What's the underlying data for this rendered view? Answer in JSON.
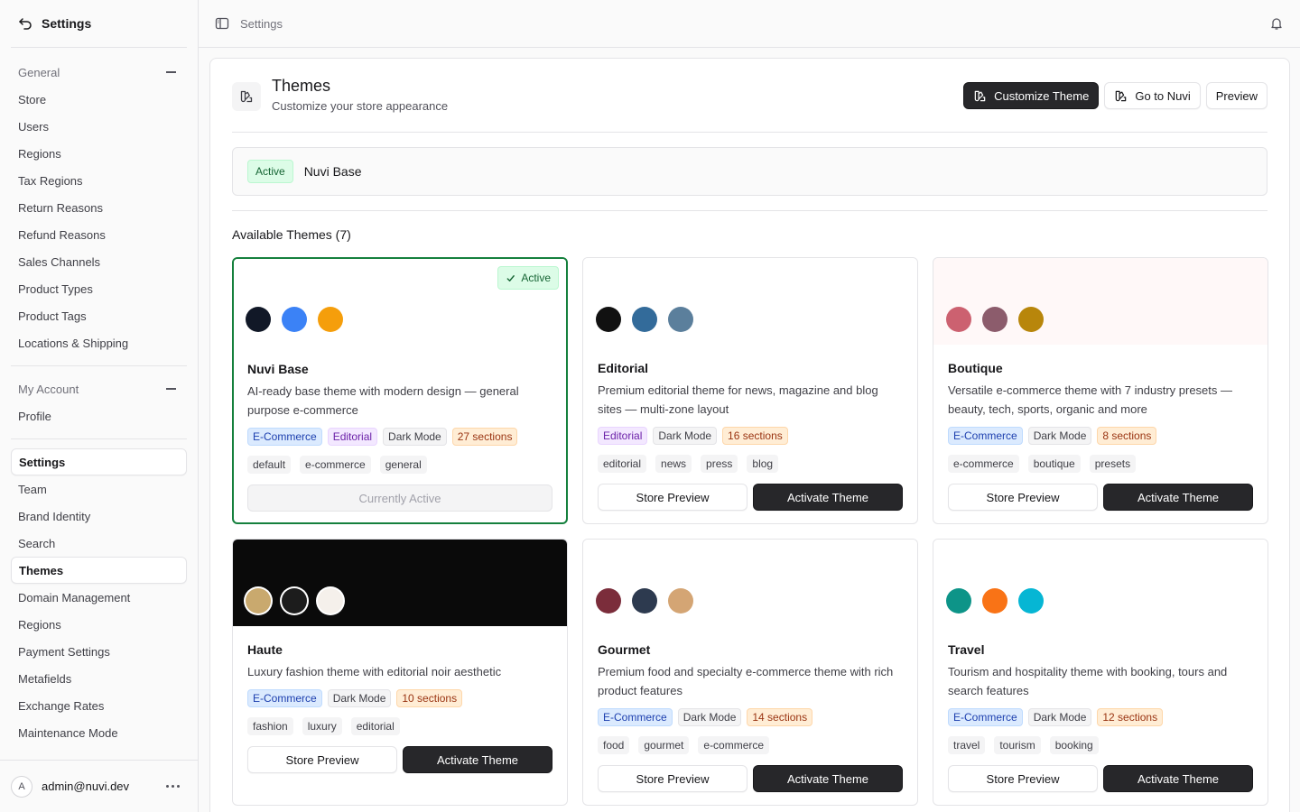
{
  "sidebar": {
    "title": "Settings",
    "groups": [
      {
        "label": "General",
        "items": [
          "Store",
          "Users",
          "Regions",
          "Tax Regions",
          "Return Reasons",
          "Refund Reasons",
          "Sales Channels",
          "Product Types",
          "Product Tags",
          "Locations & Shipping"
        ]
      },
      {
        "label": "My Account",
        "items": [
          "Profile"
        ]
      }
    ],
    "extensions": [
      "Settings",
      "Team",
      "Brand Identity",
      "Search",
      "Themes",
      "Domain Management",
      "Regions",
      "Payment Settings",
      "Metafields",
      "Exchange Rates",
      "Maintenance Mode"
    ],
    "user": {
      "initial": "A",
      "email": "admin@nuvi.dev"
    }
  },
  "topbar": {
    "breadcrumb": "Settings"
  },
  "page": {
    "title": "Themes",
    "subtitle": "Customize your store appearance",
    "actions": {
      "customize": "Customize Theme",
      "go_to_nuvi": "Go to Nuvi",
      "preview": "Preview"
    },
    "active_badge": "Active",
    "active_theme": "Nuvi Base",
    "available_heading": "Available Themes (7)"
  },
  "labels": {
    "store_preview": "Store Preview",
    "activate": "Activate Theme",
    "currently_active": "Currently Active",
    "active": "Active"
  },
  "themes": [
    {
      "name": "Nuvi Base",
      "description": "AI-ready base theme with modern design — general purpose e-commerce",
      "colors": [
        "#111827",
        "#3b82f6",
        "#f59e0b"
      ],
      "banner": "#ffffff",
      "badges": [
        "E-Commerce",
        "Editorial",
        "Dark Mode",
        "27 sections"
      ],
      "tags": [
        "default",
        "e-commerce",
        "general"
      ],
      "current": true
    },
    {
      "name": "Editorial",
      "description": "Premium editorial theme for news, magazine and blog sites — multi-zone layout",
      "colors": [
        "#111111",
        "#336b9a",
        "#5b7f9c"
      ],
      "banner": "#ffffff",
      "badges": [
        "Editorial",
        "Dark Mode",
        "16 sections"
      ],
      "tags": [
        "editorial",
        "news",
        "press",
        "blog"
      ]
    },
    {
      "name": "Boutique",
      "description": "Versatile e-commerce theme with 7 industry presets — beauty, tech, sports, organic and more",
      "colors": [
        "#cc6170",
        "#8c5c6c",
        "#b8860b"
      ],
      "banner": "#fff8f8",
      "badges": [
        "E-Commerce",
        "Dark Mode",
        "8 sections"
      ],
      "tags": [
        "e-commerce",
        "boutique",
        "presets"
      ]
    },
    {
      "name": "Haute",
      "description": "Luxury fashion theme with editorial noir aesthetic",
      "colors": [
        "#c9a96e",
        "#1c1c1c",
        "#f5f0eb"
      ],
      "banner": "#0a0a0a",
      "badges": [
        "E-Commerce",
        "Dark Mode",
        "10 sections"
      ],
      "tags": [
        "fashion",
        "luxury",
        "editorial"
      ]
    },
    {
      "name": "Gourmet",
      "description": "Premium food and specialty e-commerce theme with rich product features",
      "colors": [
        "#7b2d3b",
        "#2d3a4f",
        "#d4a574"
      ],
      "banner": "#ffffff",
      "badges": [
        "E-Commerce",
        "Dark Mode",
        "14 sections"
      ],
      "tags": [
        "food",
        "gourmet",
        "e-commerce"
      ]
    },
    {
      "name": "Travel",
      "description": "Tourism and hospitality theme with booking, tours and search features",
      "colors": [
        "#0d9488",
        "#f97316",
        "#06b6d4"
      ],
      "banner": "#ffffff",
      "badges": [
        "E-Commerce",
        "Dark Mode",
        "12 sections"
      ],
      "tags": [
        "travel",
        "tourism",
        "booking"
      ]
    }
  ],
  "badge_styles": {
    "E-Commerce": "blue",
    "Editorial": "purple",
    "Dark Mode": "gray"
  }
}
